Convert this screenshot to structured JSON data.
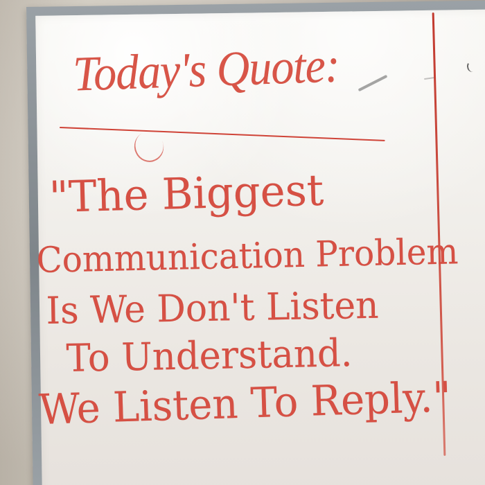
{
  "whiteboard": {
    "heading": "Today's Quote:",
    "quote_lines": [
      "\"The Biggest",
      "Communication Problem",
      "Is We Don't Listen",
      "To Understand.",
      "We Listen To Reply.\""
    ]
  },
  "colors": {
    "marker": "#d65044",
    "board": "#f4f2ee",
    "frame": "#8f969b",
    "wall": "#cfc7bb"
  }
}
